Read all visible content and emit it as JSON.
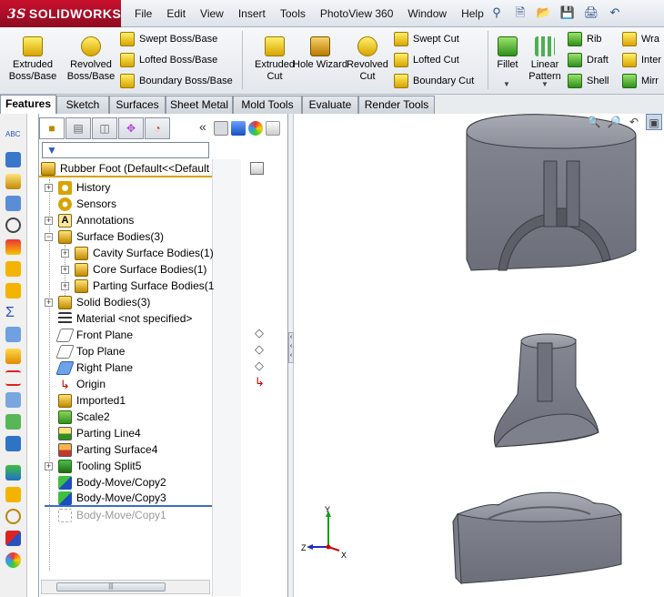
{
  "app": {
    "logo_text": "SOLIDWORKS",
    "logo_mark": "3S"
  },
  "menu": [
    "File",
    "Edit",
    "View",
    "Insert",
    "Tools",
    "PhotoView 360",
    "Window",
    "Help"
  ],
  "ribbon": {
    "extruded_boss": "Extruded Boss/Base",
    "revolved_boss": "Revolved Boss/Base",
    "swept_boss": "Swept Boss/Base",
    "lofted_boss": "Lofted Boss/Base",
    "boundary_boss": "Boundary Boss/Base",
    "extruded_cut": "Extruded Cut",
    "hole_wizard": "Hole Wizard",
    "revolved_cut": "Revolved Cut",
    "swept_cut": "Swept Cut",
    "lofted_cut": "Lofted Cut",
    "boundary_cut": "Boundary Cut",
    "fillet": "Fillet",
    "linear_pattern": "Linear Pattern",
    "rib": "Rib",
    "draft": "Draft",
    "shell": "Shell",
    "wrap": "Wra",
    "intersect": "Inter",
    "mirror": "Mirr"
  },
  "tabs": [
    "Features",
    "Sketch",
    "Surfaces",
    "Sheet Metal",
    "Mold Tools",
    "Evaluate",
    "Render Tools"
  ],
  "tree": {
    "root": "Rubber Foot  (Default<<Default",
    "items": [
      "History",
      "Sensors",
      "Annotations",
      "Surface Bodies(3)",
      "Cavity Surface Bodies(1)",
      "Core Surface Bodies(1)",
      "Parting Surface Bodies(1",
      "Solid Bodies(3)",
      "Material <not specified>",
      "Front Plane",
      "Top Plane",
      "Right Plane",
      "Origin",
      "Imported1",
      "Scale2",
      "Parting Line4",
      "Parting Surface4",
      "Tooling Split5",
      "Body-Move/Copy2",
      "Body-Move/Copy3",
      "Body-Move/Copy1"
    ]
  },
  "triad": {
    "x": "X",
    "y": "Y",
    "z": "Z"
  },
  "colors": {
    "accent_red": "#c8102e",
    "body_gray": "#7f8290",
    "tree_yellow": "#f2c200"
  }
}
